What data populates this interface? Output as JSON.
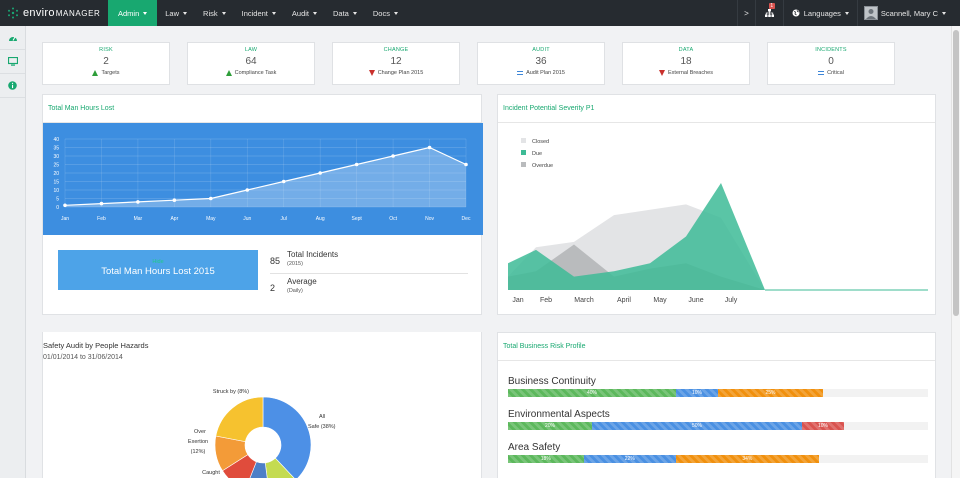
{
  "brand": {
    "part1": "enviro",
    "part2": "MANAGER"
  },
  "nav": {
    "items": [
      {
        "label": "Admin",
        "active": true
      },
      {
        "label": "Law",
        "active": false
      },
      {
        "label": "Risk",
        "active": false
      },
      {
        "label": "Incident",
        "active": false
      },
      {
        "label": "Audit",
        "active": false
      },
      {
        "label": "Data",
        "active": false
      },
      {
        "label": "Docs",
        "active": false
      }
    ],
    "chevron": ">",
    "notification_count": "1",
    "languages_label": "Languages",
    "user_name": "Scannell, Mary C"
  },
  "kpis": [
    {
      "label": "RISK",
      "value": "2",
      "indicator": "up",
      "subtext": "Targets"
    },
    {
      "label": "LAW",
      "value": "64",
      "indicator": "up",
      "subtext": "Compliance Task"
    },
    {
      "label": "CHANGE",
      "value": "12",
      "indicator": "down",
      "subtext": "Change Plan 2015"
    },
    {
      "label": "AUDIT",
      "value": "36",
      "indicator": "equal",
      "subtext": "Audit Plan 2015"
    },
    {
      "label": "DATA",
      "value": "18",
      "indicator": "down",
      "subtext": "External Breaches"
    },
    {
      "label": "INCIDENTS",
      "value": "0",
      "indicator": "equal",
      "subtext": "Critical"
    }
  ],
  "man_hours": {
    "title": "Total Man Hours Lost",
    "box_small": "Hide",
    "box_big": "Total Man Hours Lost 2015",
    "stats": [
      {
        "value": "85",
        "label": "Total Incidents",
        "sub": "(2015)"
      },
      {
        "value": "2",
        "label": "Average",
        "sub": "(Daily)"
      }
    ]
  },
  "severity": {
    "title": "Incident Potential Severity P1"
  },
  "safety_audit": {
    "title": "Safety Audit by People Hazards",
    "date_range": "01/01/2014 to 31/06/2014"
  },
  "business_risk": {
    "title": "Total Business Risk Profile",
    "items": [
      {
        "label": "Business Continuity",
        "segments": [
          {
            "color": "#5cb85c",
            "pct": 40,
            "label": "40%"
          },
          {
            "color": "#4a90e2",
            "pct": 10,
            "label": "10%"
          },
          {
            "color": "#f0900e",
            "pct": 25,
            "label": "25%"
          }
        ]
      },
      {
        "label": "Environmental Aspects",
        "segments": [
          {
            "color": "#5cb85c",
            "pct": 20,
            "label": "20%"
          },
          {
            "color": "#4a90e2",
            "pct": 50,
            "label": "50%"
          },
          {
            "color": "#d9534f",
            "pct": 10,
            "label": "10%"
          }
        ]
      },
      {
        "label": "Area Safety",
        "segments": [
          {
            "color": "#5cb85c",
            "pct": 18,
            "label": "18%"
          },
          {
            "color": "#4a90e2",
            "pct": 22,
            "label": "22%"
          },
          {
            "color": "#f0900e",
            "pct": 34,
            "label": "34%"
          }
        ]
      }
    ]
  },
  "chart_data": [
    {
      "type": "line",
      "title": "Total Man Hours Lost",
      "categories": [
        "Jan",
        "Feb",
        "Mar",
        "Apr",
        "May",
        "Jun",
        "Jul",
        "Aug",
        "Sept",
        "Oct",
        "Nov",
        "Dec"
      ],
      "values": [
        1,
        2,
        3,
        4,
        5,
        10,
        15,
        20,
        25,
        30,
        35,
        25
      ],
      "yticks": [
        "0",
        "5",
        "10",
        "15",
        "20",
        "25",
        "30",
        "35",
        "40"
      ],
      "ylim": [
        0,
        40
      ],
      "grid": true,
      "background": "#3d8ee0"
    },
    {
      "type": "area",
      "title": "Incident Potential Severity P1",
      "categories": [
        "Jan",
        "Feb",
        "March",
        "April",
        "May",
        "June",
        "July"
      ],
      "legend": [
        "Closed",
        "Due",
        "Overdue"
      ],
      "legend_position": "top-left",
      "series": [
        {
          "name": "Closed",
          "color": "#e3e4e6",
          "values": [
            5,
            16,
            18,
            28,
            30,
            32,
            27,
            0
          ]
        },
        {
          "name": "Overdue",
          "color": "#b9bbbd",
          "values": [
            5,
            7,
            17,
            5,
            8,
            10,
            5,
            0
          ]
        },
        {
          "name": "Due",
          "color": "#3dbb96",
          "values": [
            10,
            15,
            5,
            7,
            10,
            20,
            40,
            0
          ]
        }
      ]
    },
    {
      "type": "pie",
      "title": "Safety Audit by People Hazards",
      "slices": [
        {
          "label": "All Safe (38%)",
          "value": 38,
          "color": "#4d90e6"
        },
        {
          "label": "",
          "value": 10,
          "color": "#c4db51"
        },
        {
          "label": "",
          "value": 8,
          "color": "#4d7fc7"
        },
        {
          "label": "Caught",
          "value": 10,
          "color": "#e04c3c"
        },
        {
          "label": "Over Exertion (12%)",
          "value": 12,
          "color": "#f39b38"
        },
        {
          "label": "Struck by (8%)",
          "value": 22,
          "color": "#f6c22f"
        }
      ]
    }
  ]
}
